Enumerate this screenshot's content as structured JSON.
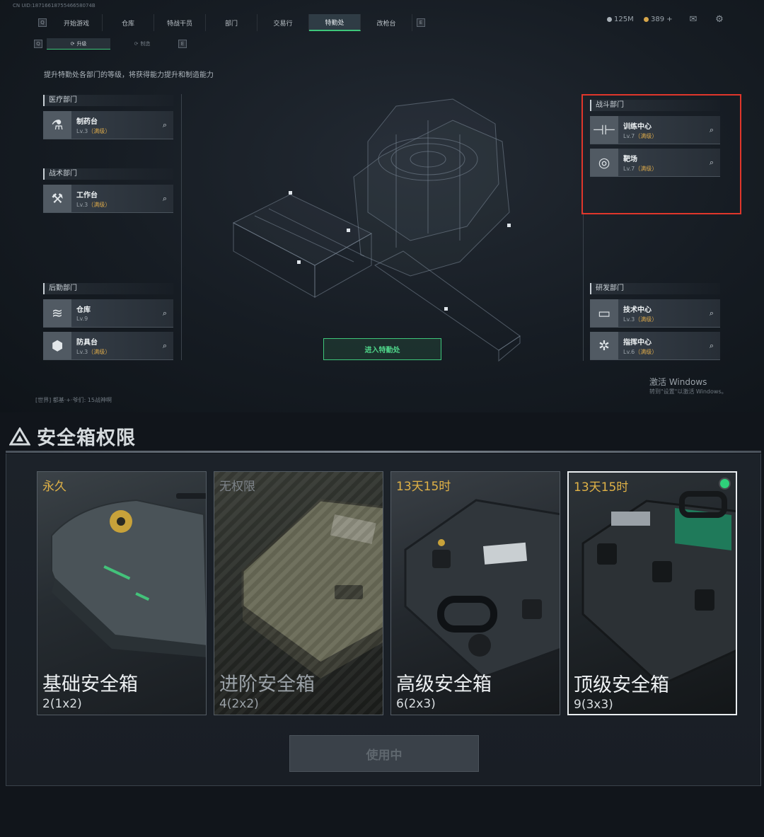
{
  "uid": "CN UID:1871661875546658074B",
  "topnav": {
    "key_left": "Q",
    "key_right": "E",
    "tabs": [
      "开始游戏",
      "仓库",
      "特战干员",
      "部门",
      "交易行",
      "特勤处",
      "改枪台"
    ],
    "active_tab": "特勤处"
  },
  "currency": {
    "coins": "125M",
    "tokens": "389 +"
  },
  "subnav": {
    "key_left": "Q",
    "key_right": "E",
    "tabs": [
      "升级",
      "制造"
    ],
    "active": "升级"
  },
  "description": "提升特勤处各部门的等级，将获得能力提升和制造能力",
  "departments": {
    "medical": {
      "title": "医疗部门",
      "items": [
        {
          "name": "制药台",
          "level": "Lv.3",
          "max": "（满级）",
          "icon": "medicine-icon"
        }
      ]
    },
    "tactical": {
      "title": "战术部门",
      "items": [
        {
          "name": "工作台",
          "level": "Lv.3",
          "max": "（满级）",
          "icon": "tools-icon"
        }
      ]
    },
    "logistics": {
      "title": "后勤部门",
      "items": [
        {
          "name": "仓库",
          "level": "Lv.9",
          "max": "",
          "icon": "rank-chevron-icon"
        },
        {
          "name": "防具台",
          "level": "Lv.3",
          "max": "（满级）",
          "icon": "cubes-icon"
        }
      ]
    },
    "combat": {
      "title": "战斗部门",
      "items": [
        {
          "name": "训练中心",
          "level": "Lv.7",
          "max": "（满级）",
          "icon": "dumbbell-icon"
        },
        {
          "name": "靶场",
          "level": "Lv.7",
          "max": "（满级）",
          "icon": "target-icon"
        }
      ]
    },
    "research": {
      "title": "研发部门",
      "items": [
        {
          "name": "技术中心",
          "level": "Lv.3",
          "max": "（满级）",
          "icon": "monitor-icon"
        },
        {
          "name": "指挥中心",
          "level": "Lv.6",
          "max": "（满级）",
          "icon": "command-icon"
        }
      ]
    }
  },
  "enter_button": "进入特勤处",
  "windows_activation": {
    "line1": "激活 Windows",
    "line2": "转到\"设置\"以激活 Windows。"
  },
  "world_chat": "[世界] 都基·+·爷们: 15战神啊",
  "safebox": {
    "title": "安全箱权限",
    "boxes": [
      {
        "tag": "永久",
        "tag_color": "#e0b247",
        "name": "基础安全箱",
        "size": "2(1x2)",
        "locked": false,
        "selected": false
      },
      {
        "tag": "无权限",
        "tag_color": "#7d8389",
        "name": "进阶安全箱",
        "size": "4(2x2)",
        "locked": true,
        "selected": false
      },
      {
        "tag": "13天15时",
        "tag_color": "#e0b247",
        "name": "高级安全箱",
        "size": "6(2x3)",
        "locked": false,
        "selected": false
      },
      {
        "tag": "13天15时",
        "tag_color": "#e0b247",
        "name": "顶级安全箱",
        "size": "9(3x3)",
        "locked": false,
        "selected": true
      }
    ],
    "use_button": "使用中"
  },
  "colors": {
    "accent_green": "#3ec67a",
    "highlight_red": "#e0362b",
    "gold": "#e0b247"
  }
}
